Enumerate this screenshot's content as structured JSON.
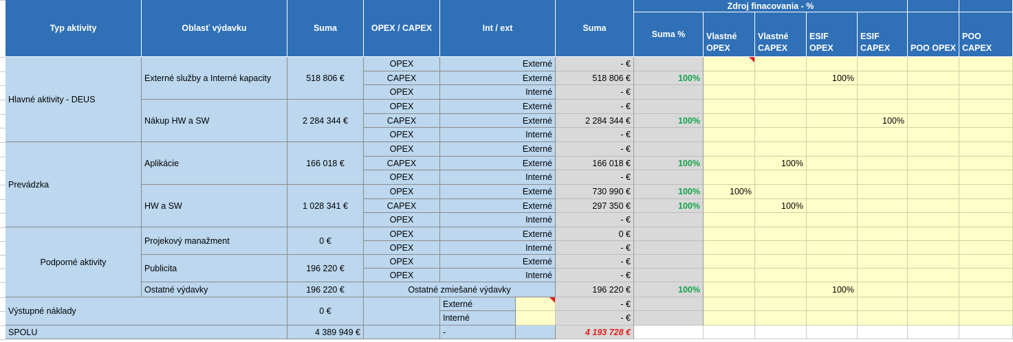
{
  "header": {
    "typ": "Typ aktivity",
    "oblast": "Oblasť výdavku",
    "suma": "Suma",
    "opex_capex": "OPEX / CAPEX",
    "int_ext": "Int / ext",
    "suma2": "Suma",
    "zdroj": "Zdroj finacovania - %",
    "suma_pct": "Suma %",
    "vlastne_opex": "Vlastné OPEX",
    "vlastne_capex": "Vlastné CAPEX",
    "esif_opex": "ESIF OPEX",
    "esif_capex": "ESIF CAPEX",
    "poo_opex": "POO OPEX",
    "poo_capex": "POO CAPEX"
  },
  "groups": [
    {
      "label": "Hlavné aktivity - DEUS"
    },
    {
      "label": "Prevádzka"
    },
    {
      "label": "Podporné aktivity"
    }
  ],
  "areas": [
    {
      "label": "Externé služby a Interné kapacity",
      "suma": "518 806 €"
    },
    {
      "label": "Nákup HW a SW",
      "suma": "2 284 344 €"
    },
    {
      "label": "Aplikácie",
      "suma": "166 018 €"
    },
    {
      "label": "HW a SW",
      "suma": "1 028 341 €"
    },
    {
      "label": "Projekový manažment",
      "suma": "0 €"
    },
    {
      "label": "Publicita",
      "suma": "196 220 €"
    },
    {
      "label": "Ostatné výdavky",
      "suma": "196 220 €"
    }
  ],
  "rows": [
    {
      "type": "OPEX",
      "ie": "Externé",
      "suma": "- €",
      "pct": "",
      "vo": "",
      "vc": "",
      "eo": "",
      "ec": ""
    },
    {
      "type": "CAPEX",
      "ie": "Externé",
      "suma": "518 806 €",
      "pct": "100%",
      "vo": "",
      "vc": "",
      "eo": "100%",
      "ec": ""
    },
    {
      "type": "OPEX",
      "ie": "Interné",
      "suma": "- €",
      "pct": "",
      "vo": "",
      "vc": "",
      "eo": "",
      "ec": ""
    },
    {
      "type": "OPEX",
      "ie": "Externé",
      "suma": "- €",
      "pct": "",
      "vo": "",
      "vc": "",
      "eo": "",
      "ec": ""
    },
    {
      "type": "CAPEX",
      "ie": "Externé",
      "suma": "2 284 344 €",
      "pct": "100%",
      "vo": "",
      "vc": "",
      "eo": "",
      "ec": "100%"
    },
    {
      "type": "OPEX",
      "ie": "Interné",
      "suma": "- €",
      "pct": "",
      "vo": "",
      "vc": "",
      "eo": "",
      "ec": ""
    },
    {
      "type": "OPEX",
      "ie": "Externé",
      "suma": "- €",
      "pct": "",
      "vo": "",
      "vc": "",
      "eo": "",
      "ec": ""
    },
    {
      "type": "CAPEX",
      "ie": "Externé",
      "suma": "166 018 €",
      "pct": "100%",
      "vo": "",
      "vc": "100%",
      "eo": "",
      "ec": ""
    },
    {
      "type": "OPEX",
      "ie": "Interné",
      "suma": "- €",
      "pct": "",
      "vo": "",
      "vc": "",
      "eo": "",
      "ec": ""
    },
    {
      "type": "OPEX",
      "ie": "Externé",
      "suma": "730 990 €",
      "pct": "100%",
      "vo": "100%",
      "vc": "",
      "eo": "",
      "ec": ""
    },
    {
      "type": "CAPEX",
      "ie": "Externé",
      "suma": "297 350 €",
      "pct": "100%",
      "vo": "",
      "vc": "100%",
      "eo": "",
      "ec": ""
    },
    {
      "type": "OPEX",
      "ie": "Interné",
      "suma": "- €",
      "pct": "",
      "vo": "",
      "vc": "",
      "eo": "",
      "ec": ""
    },
    {
      "type": "OPEX",
      "ie": "Externé",
      "suma": "0 €",
      "pct": "",
      "vo": "",
      "vc": "",
      "eo": "",
      "ec": ""
    },
    {
      "type": "OPEX",
      "ie": "Interné",
      "suma": "- €",
      "pct": "",
      "vo": "",
      "vc": "",
      "eo": "",
      "ec": ""
    },
    {
      "type": "OPEX",
      "ie": "Externé",
      "suma": "- €",
      "pct": "",
      "vo": "",
      "vc": "",
      "eo": "",
      "ec": ""
    },
    {
      "type": "OPEX",
      "ie": "Interné",
      "suma": "- €",
      "pct": "",
      "vo": "",
      "vc": "",
      "eo": "",
      "ec": ""
    }
  ],
  "ostatne_row": {
    "mixed": "Ostatné zmiešané výdavky",
    "suma": "196 220 €",
    "pct": "100%",
    "eo": "100%"
  },
  "vystupne": {
    "label": "Výstupné náklady",
    "suma": "0 €",
    "ext": "Externé",
    "int": "Interné",
    "suma_ext": "- €",
    "suma_int": "- €"
  },
  "spolu": {
    "label": "SPOLU",
    "suma": "4 389 949 €",
    "dash": "-",
    "suma2": "4 193 728 €"
  },
  "colors": {
    "header": "#2f70b6",
    "label": "#bcd7ee",
    "gray": "#d9d9d9",
    "yellow": "#fefec8",
    "green": "#16a34a",
    "red": "#e02020"
  }
}
